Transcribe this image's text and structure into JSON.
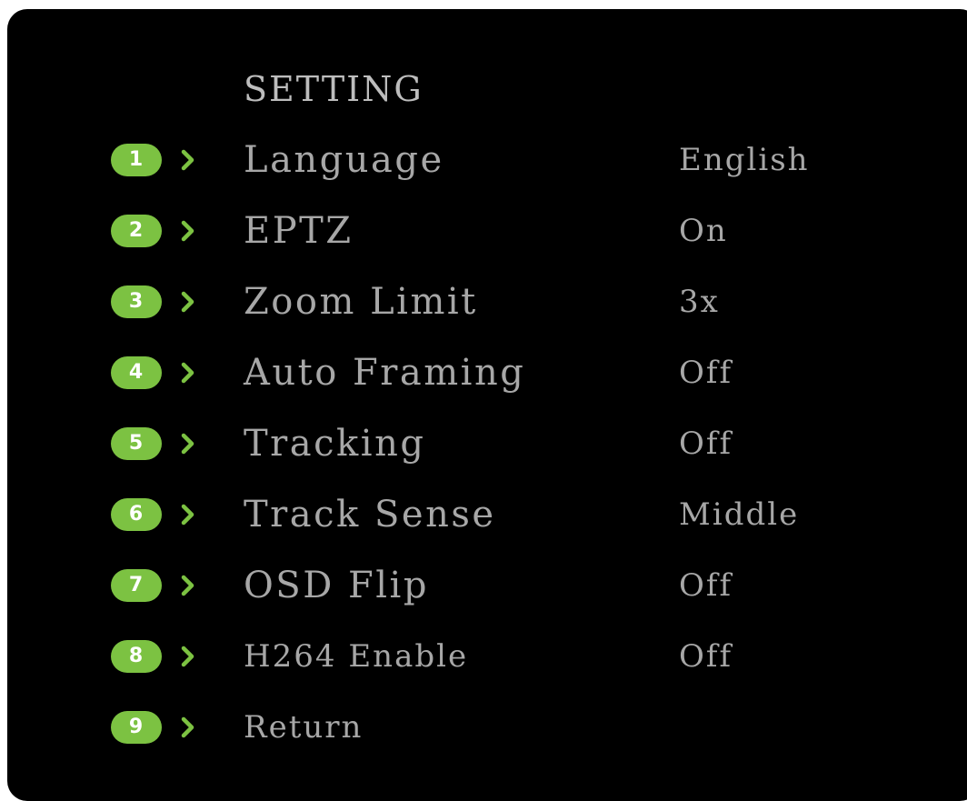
{
  "menu": {
    "title": "SETTING",
    "items": [
      {
        "number": "1",
        "label": "Language",
        "value": "English"
      },
      {
        "number": "2",
        "label": "EPTZ",
        "value": "On"
      },
      {
        "number": "3",
        "label": "Zoom Limit",
        "value": "3x"
      },
      {
        "number": "4",
        "label": "Auto Framing",
        "value": "Off"
      },
      {
        "number": "5",
        "label": "Tracking",
        "value": "Off"
      },
      {
        "number": "6",
        "label": "Track Sense",
        "value": "Middle"
      },
      {
        "number": "7",
        "label": "OSD Flip",
        "value": "Off"
      },
      {
        "number": "8",
        "label": "H264 Enable",
        "value": "Off"
      },
      {
        "number": "9",
        "label": "Return",
        "value": ""
      }
    ]
  },
  "colors": {
    "background": "#000000",
    "badge": "#7cc242",
    "chevron": "#7cc242",
    "text": "#a7a7a7"
  },
  "icons": {
    "chevron": "chevron-right-icon"
  }
}
